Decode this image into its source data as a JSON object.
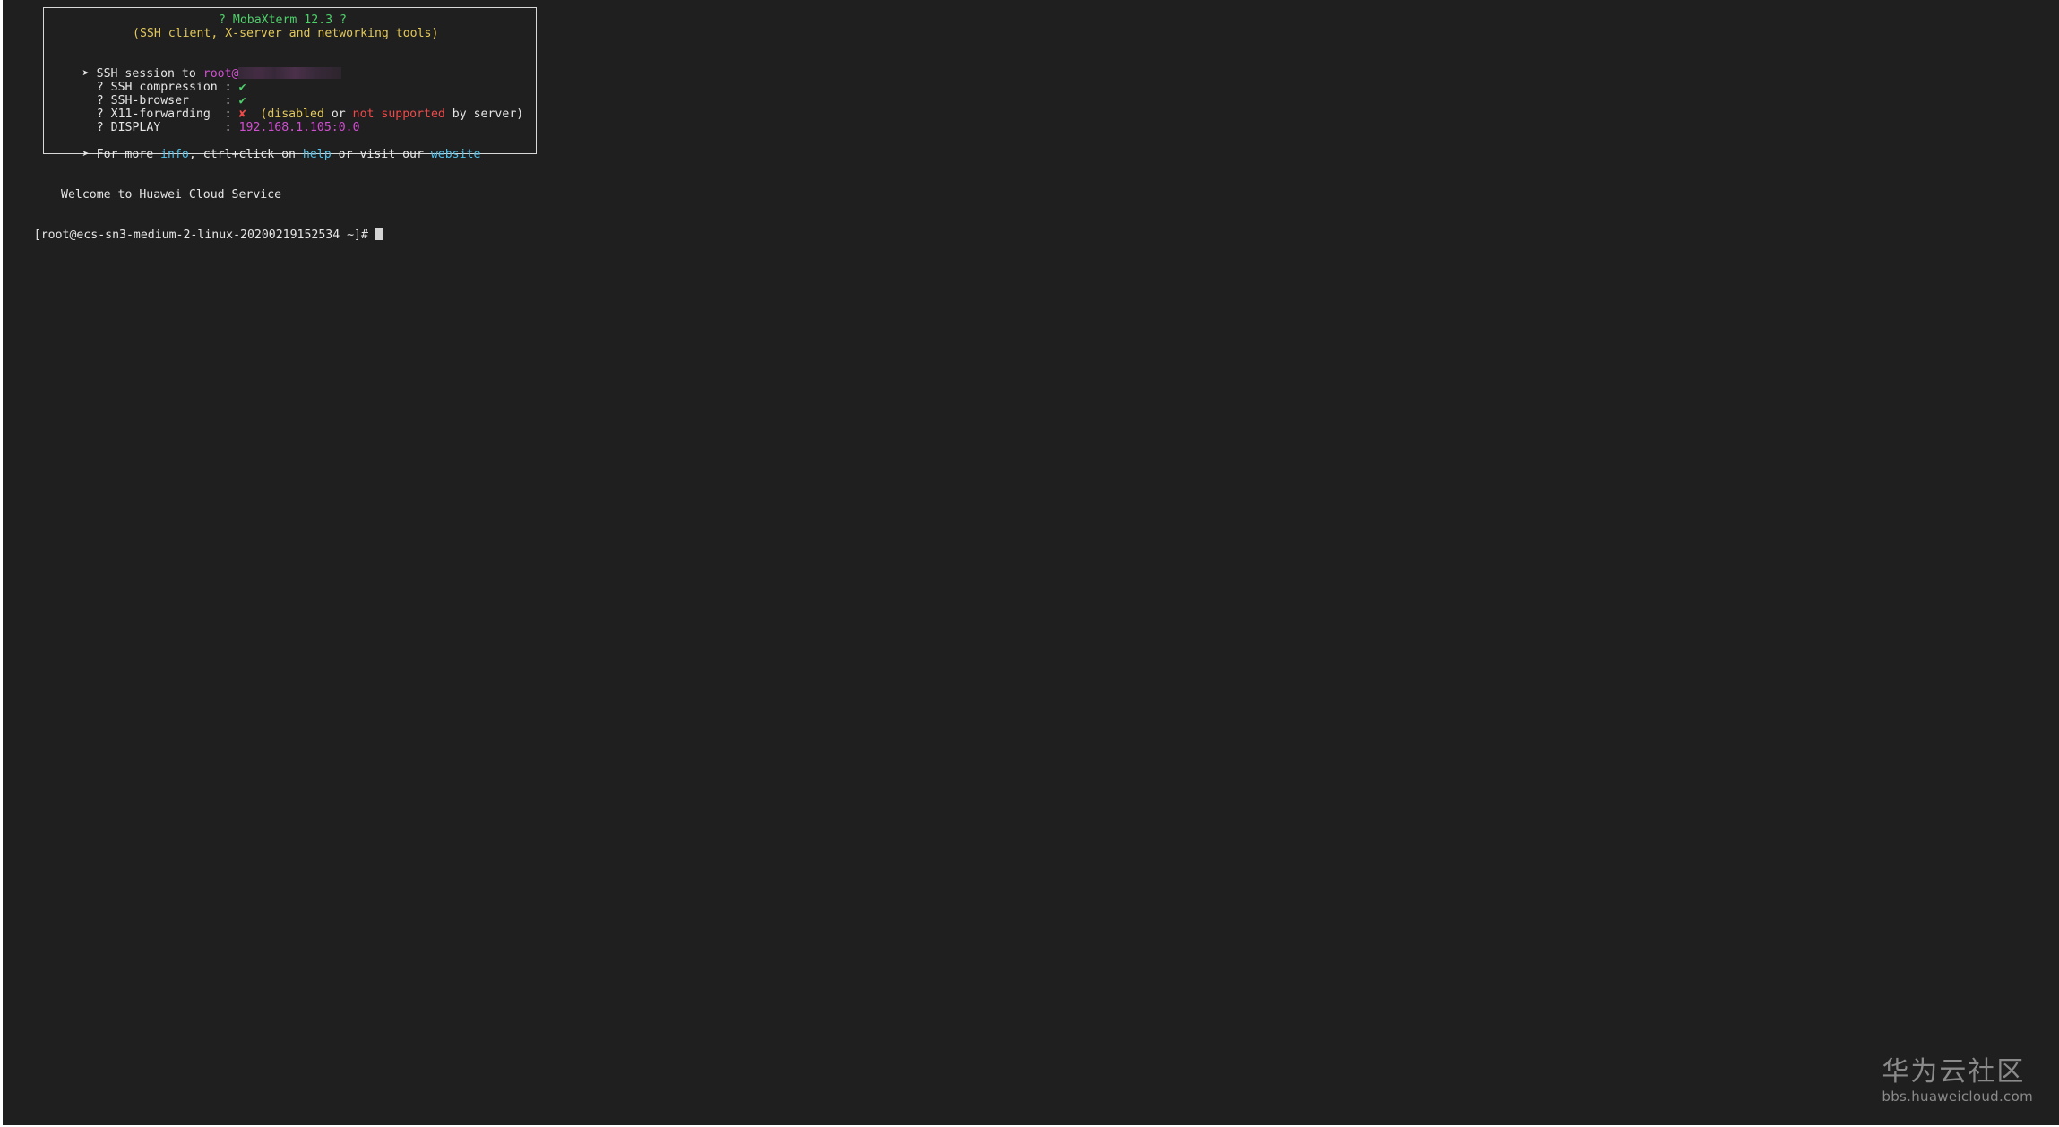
{
  "banner": {
    "title_line": "? MobaXterm 12.3 ?",
    "subtitle_line": "(SSH client, X-server and networking tools)",
    "session_prefix": "➤ SSH session to ",
    "session_user": "root@",
    "rows": [
      {
        "label": "? SSH compression : ",
        "value": "✔"
      },
      {
        "label": "? SSH-browser     : ",
        "value": "✔"
      },
      {
        "label": "? X11-forwarding  : ",
        "value": "✘"
      },
      {
        "label": "? DISPLAY         : ",
        "value": "192.168.1.105:0.0"
      }
    ],
    "x11_note": {
      "open": "  (",
      "disabled": "disabled",
      "or": " or ",
      "not_supported": "not supported",
      "tail": " by server)"
    },
    "more": {
      "prefix": "➤ For more ",
      "info": "info",
      "mid": ", ctrl+click on ",
      "help": "help",
      "or_visit": " or visit our ",
      "website": "website"
    }
  },
  "welcome": "Welcome to Huawei Cloud Service",
  "prompt": "[root@ecs-sn3-medium-2-linux-20200219152534 ~]# ",
  "watermark": {
    "title": "华为云社区",
    "url": "bbs.huaweicloud.com"
  }
}
